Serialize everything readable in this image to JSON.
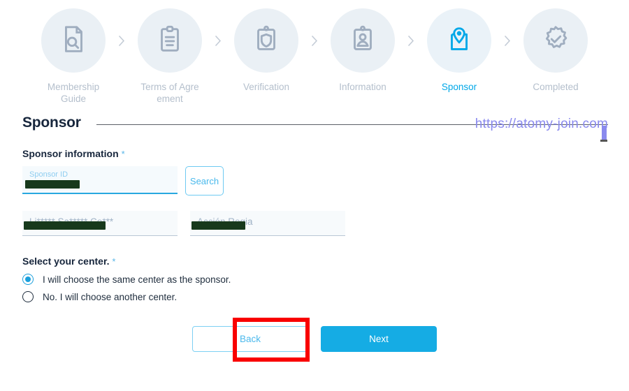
{
  "stepper": {
    "steps": [
      {
        "label": "Membership Guide",
        "icon": "document-search-icon",
        "active": false
      },
      {
        "label": "Terms of Agre ement",
        "icon": "clipboard-list-icon",
        "active": false
      },
      {
        "label": "Verification",
        "icon": "clipboard-shield-icon",
        "active": false
      },
      {
        "label": "Information",
        "icon": "id-badge-icon",
        "active": false
      },
      {
        "label": "Sponsor",
        "icon": "map-pin-icon",
        "active": true
      },
      {
        "label": "Completed",
        "icon": "rosette-check-icon",
        "active": false
      }
    ],
    "separator_icon": "chevron-right-icon"
  },
  "section": {
    "title": "Sponsor",
    "watermark": "https://atomy-join.com"
  },
  "form": {
    "sponsor_information_label": "Sponsor information",
    "required_mark": "*",
    "sponsor_id": {
      "label": "Sponsor ID",
      "value": "",
      "redacted": true
    },
    "search_button": "Search",
    "sponsor_name": {
      "value": "Li***** Sa***** Co***",
      "redacted": true
    },
    "sponsor_center": {
      "value": "Acción Regia",
      "redacted": true
    },
    "select_center_label": "Select your center.",
    "center_options": [
      {
        "label": "I will choose the same center as the sponsor.",
        "selected": true
      },
      {
        "label": "No. I will choose another center.",
        "selected": false
      }
    ]
  },
  "footer": {
    "back_button": "Back",
    "next_button": "Next"
  },
  "colors": {
    "accent": "#15ace4",
    "active_step": "#00a8e8",
    "inactive_step": "#b4bfcc",
    "step_circle": "#eaf0f5",
    "title": "#17263c",
    "watermark": "#8a8aee",
    "annotation": "#f90000",
    "redaction": "#17391c"
  }
}
